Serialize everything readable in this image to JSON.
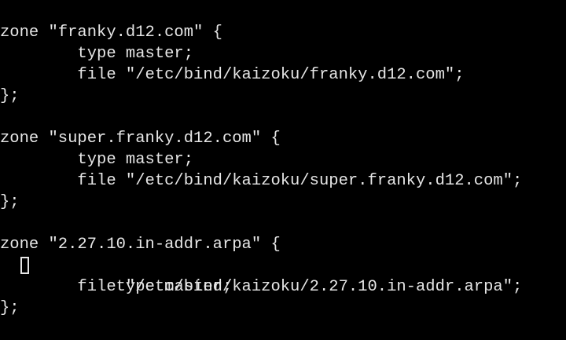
{
  "colors": {
    "background": "#000000",
    "foreground": "#e6e6e6"
  },
  "terminal": {
    "lines": [
      "zone \"franky.d12.com\" {",
      "        type master;",
      "        file \"/etc/bind/kaizoku/franky.d12.com\";",
      "};",
      "",
      "zone \"super.franky.d12.com\" {",
      "        type master;",
      "        file \"/etc/bind/kaizoku/super.franky.d12.com\";",
      "};",
      "",
      "zone \"2.27.10.in-addr.arpa\" {",
      "        type master;",
      "        file \"/etc/bind/kaizoku/2.27.10.in-addr.arpa\";",
      "};"
    ],
    "cursor_line_index": 11
  }
}
